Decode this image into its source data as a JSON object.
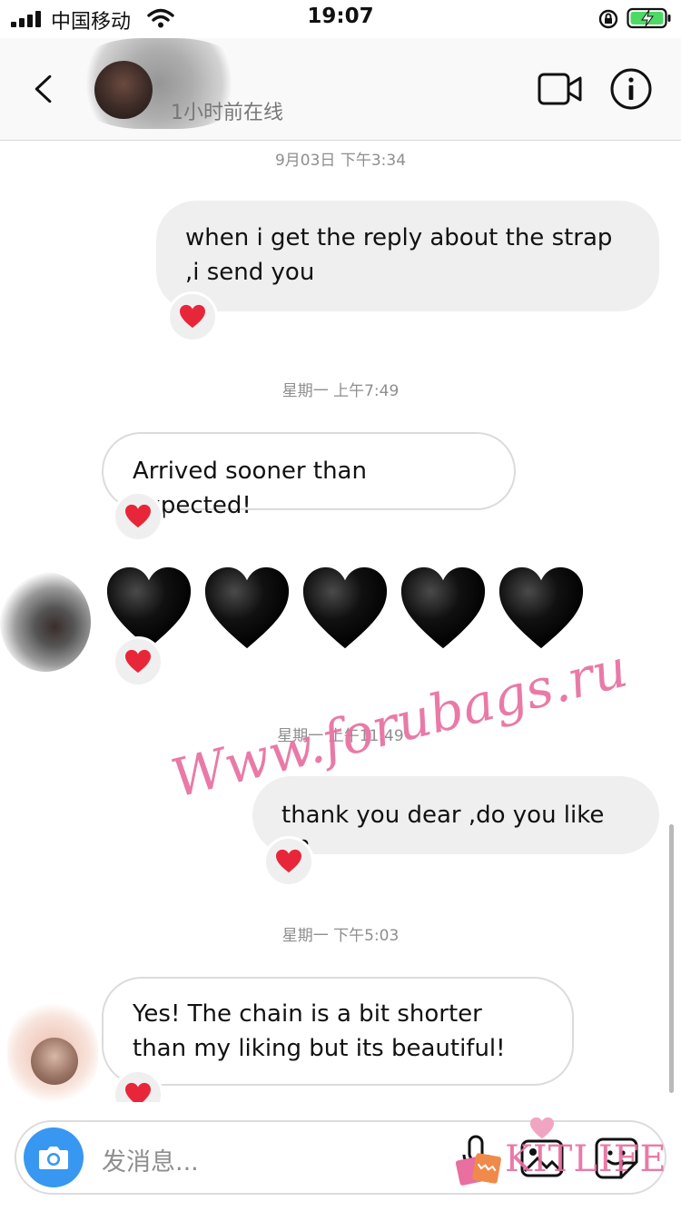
{
  "status_bar": {
    "carrier": "中国移动",
    "time": "19:07"
  },
  "header": {
    "presence": "1小时前在线"
  },
  "messages": [
    {
      "timestamp": "9月03日 下午3:34"
    },
    {
      "text": "when i get the reply about the strap ,i send you",
      "direction": "outgoing",
      "reaction": "heart"
    },
    {
      "timestamp": "星期一 上午7:49"
    },
    {
      "text": "Arrived sooner than expected!",
      "direction": "incoming",
      "reaction": "heart"
    },
    {
      "emoji": "black-heart x5",
      "direction": "incoming",
      "reaction": "heart"
    },
    {
      "timestamp": "星期一 上午11:49"
    },
    {
      "text": "thank you dear ,do you like it?",
      "direction": "outgoing",
      "reaction": "heart"
    },
    {
      "timestamp": "星期一 下午5:03"
    },
    {
      "text": "Yes! The chain is a bit shorter than my liking but its beautiful!",
      "direction": "incoming",
      "reaction": "heart"
    }
  ],
  "watermarks": {
    "site": "Www.forubags.ru",
    "brand": "KITLIFE"
  },
  "composer": {
    "placeholder": "发消息..."
  },
  "colors": {
    "accent_blue": "#3897f0",
    "reaction_red": "#e8263a",
    "watermark_pink": "#e86fa0",
    "battery_green": "#4cd964"
  }
}
